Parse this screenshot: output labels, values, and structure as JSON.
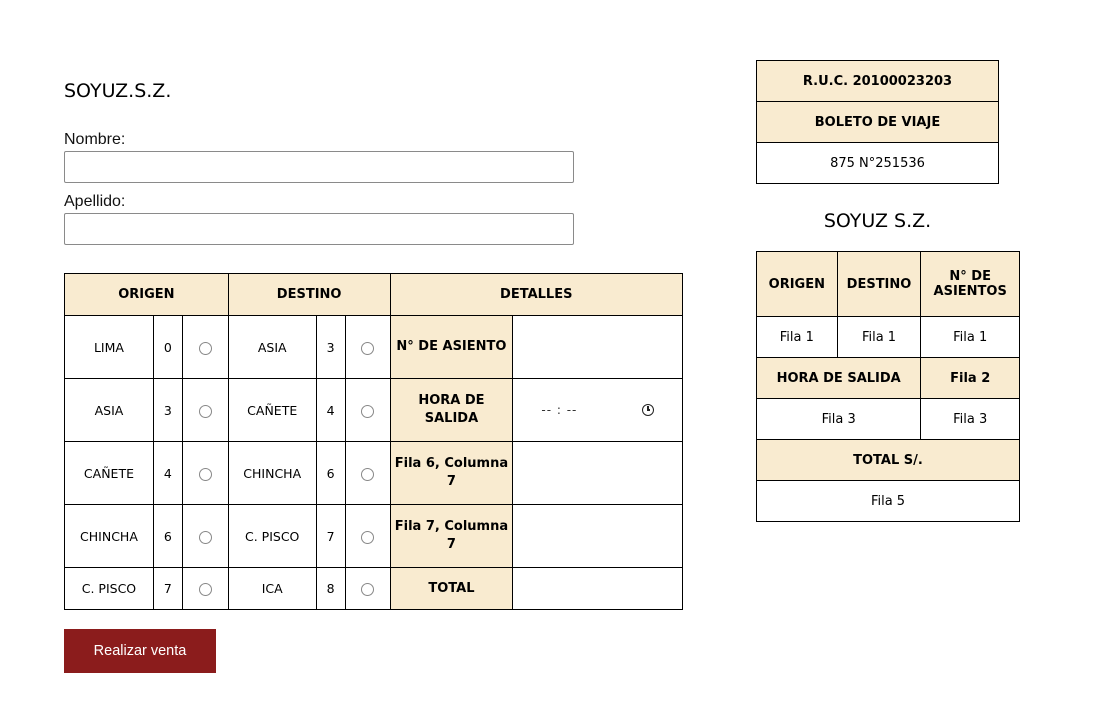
{
  "form": {
    "brand": "SOYUZ.S.Z.",
    "nombre_label": "Nombre:",
    "nombre_value": "",
    "apellido_label": "Apellido:",
    "apellido_value": "",
    "submit_label": "Realizar venta"
  },
  "main_table": {
    "headers": {
      "origen": "ORIGEN",
      "destino": "DESTINO",
      "detalles": "DETALLES"
    },
    "rows": [
      {
        "origen": "LIMA",
        "origen_num": "0",
        "destino": "ASIA",
        "destino_num": "3",
        "detail_label": "N° DE ASIENTO",
        "detail_value": ""
      },
      {
        "origen": "ASIA",
        "origen_num": "3",
        "destino": "CAÑETE",
        "destino_num": "4",
        "detail_label": "HORA DE SALIDA",
        "detail_value": "-- : --"
      },
      {
        "origen": "CAÑETE",
        "origen_num": "4",
        "destino": "CHINCHA",
        "destino_num": "6",
        "detail_label": "Fila 6, Columna 7",
        "detail_value": ""
      },
      {
        "origen": "CHINCHA",
        "origen_num": "6",
        "destino": "C. PISCO",
        "destino_num": "7",
        "detail_label": "Fila 7, Columna 7",
        "detail_value": ""
      },
      {
        "origen": "C. PISCO",
        "origen_num": "7",
        "destino": "ICA",
        "destino_num": "8",
        "detail_label": "TOTAL",
        "detail_value": ""
      }
    ]
  },
  "ticket": {
    "ruc": "R.U.C. 20100023203",
    "title": "BOLETO DE VIAJE",
    "number": "875 N°251536",
    "company": "SOYUZ S.Z."
  },
  "summary": {
    "h_origen": "ORIGEN",
    "h_destino": "DESTINO",
    "h_asientos": "N° DE ASIENTOS",
    "r1_origen": "Fila 1",
    "r1_destino": "Fila 1",
    "r1_asientos": "Fila 1",
    "hora_label": "HORA DE SALIDA",
    "fila2": "Fila 2",
    "r3_a": "Fila 3",
    "r3_b": "Fila 3",
    "total_label": "TOTAL S/.",
    "fila5": "Fila 5"
  },
  "colors": {
    "header_bg": "#f9ebd0",
    "button_bg": "#8b1c1c"
  }
}
